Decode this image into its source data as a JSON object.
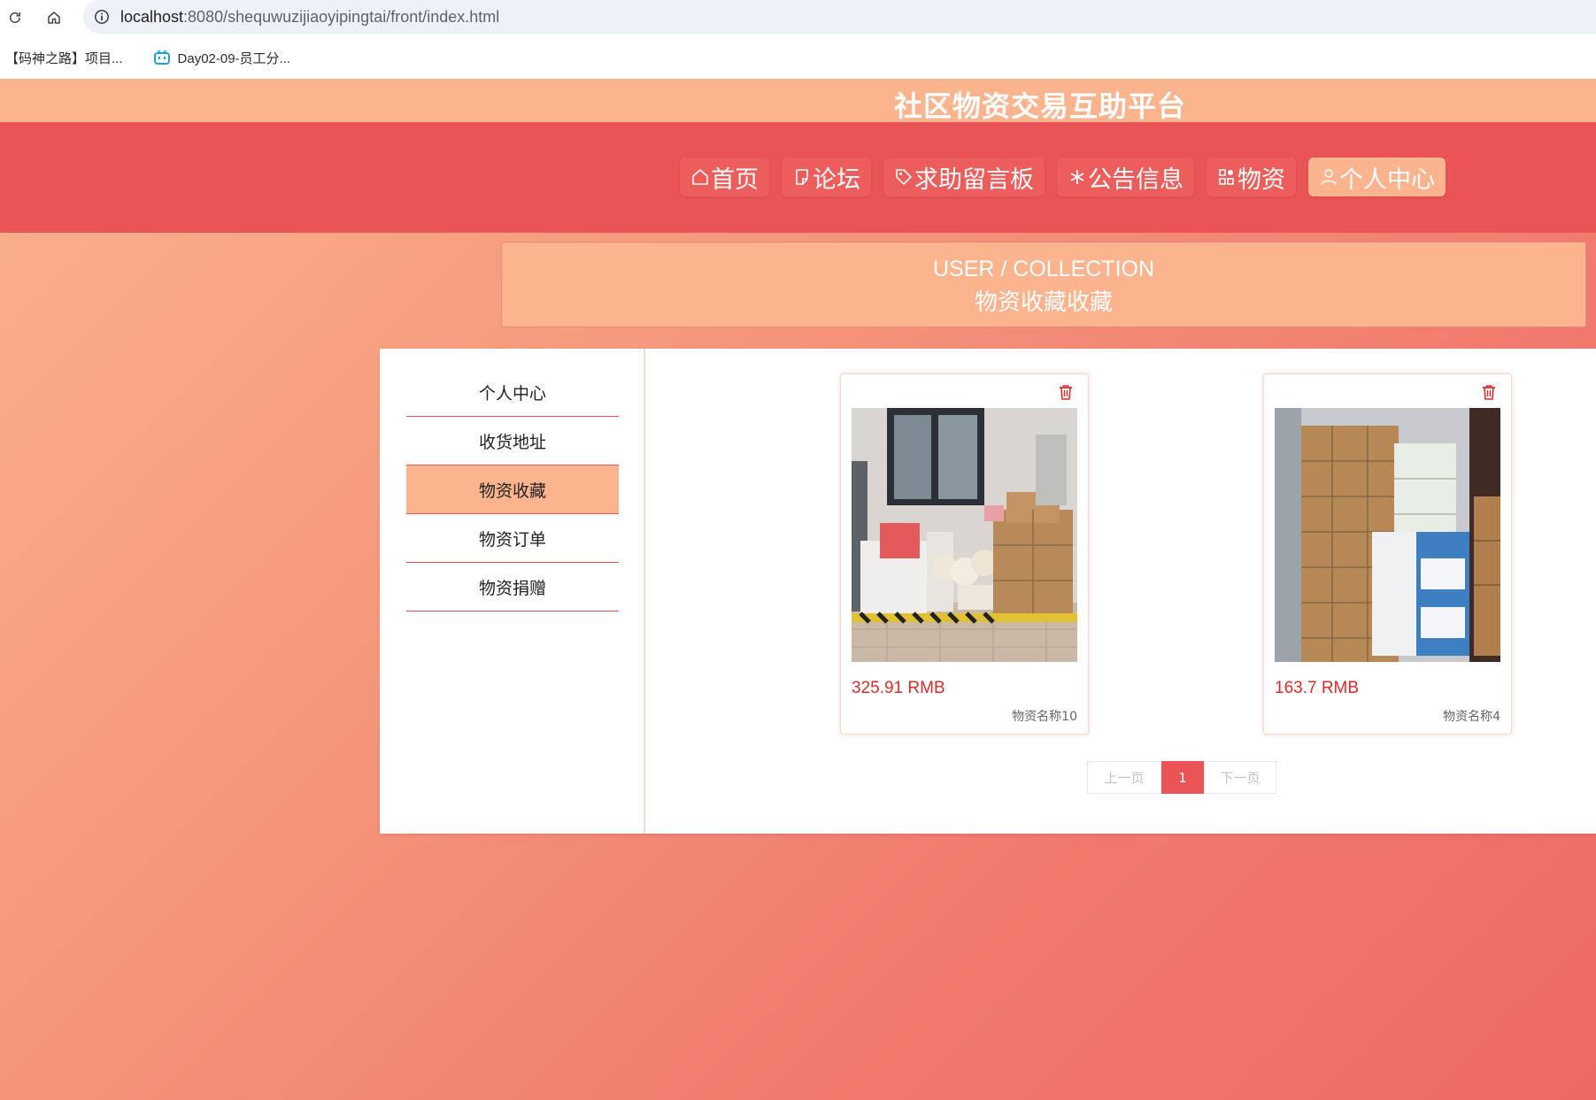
{
  "browser": {
    "url_host": "localhost",
    "url_rest": ":8080/shequwuzijiaoyipingtai/front/index.html",
    "bookmarks": [
      {
        "label": "【码神之路】项目..."
      },
      {
        "label": "Day02-09-员工分..."
      }
    ]
  },
  "site": {
    "title": "社区物资交易互助平台"
  },
  "nav": {
    "items": [
      {
        "label": "首页",
        "icon": "home-icon"
      },
      {
        "label": "论坛",
        "icon": "note-icon"
      },
      {
        "label": "求助留言板",
        "icon": "tag-icon"
      },
      {
        "label": "公告信息",
        "icon": "snowflake-icon"
      },
      {
        "label": "物资",
        "icon": "grid-icon"
      },
      {
        "label": "个人中心",
        "icon": "user-icon",
        "active": true
      }
    ]
  },
  "page_header": {
    "en": "USER / COLLECTION",
    "cn": "物资收藏收藏"
  },
  "sidebar": {
    "items": [
      {
        "label": "个人中心"
      },
      {
        "label": "收货地址"
      },
      {
        "label": "物资收藏",
        "active": true
      },
      {
        "label": "物资订单"
      },
      {
        "label": "物资捐赠"
      }
    ]
  },
  "cards": [
    {
      "price": "325.91 RMB",
      "name": "物资名称10"
    },
    {
      "price": "163.7 RMB",
      "name": "物资名称4"
    }
  ],
  "pagination": {
    "prev": "上一页",
    "current": "1",
    "next": "下一页"
  },
  "colors": {
    "primary": "#eb5456",
    "accent": "#fcb48f",
    "price": "#e02a2a"
  }
}
